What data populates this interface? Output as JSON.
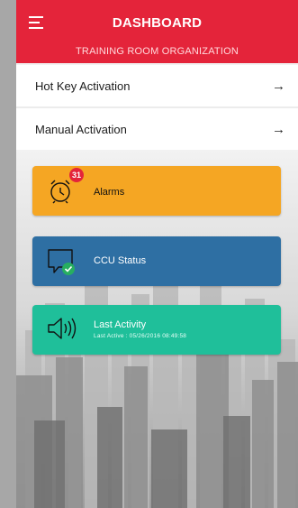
{
  "header": {
    "title": "DASHBOARD",
    "subtitle": "TRAINING ROOM ORGANIZATION",
    "color": "#e4243a"
  },
  "menu": [
    {
      "label": "Hot Key Activation",
      "icon": "arrow-right-icon"
    },
    {
      "label": "Manual Activation",
      "icon": "arrow-right-icon"
    }
  ],
  "tiles": {
    "alarms": {
      "label": "Alarms",
      "badge": "31",
      "icon": "alarm-clock-icon",
      "color": "#f5a623"
    },
    "ccu": {
      "label": "CCU Status",
      "icon": "chat-check-icon",
      "color": "#2e6fa3"
    },
    "last": {
      "label": "Last Activity",
      "sub": "Last Active : 05/26/2016 08:49:58",
      "icon": "speaker-icon",
      "color": "#1fbf9a"
    }
  }
}
